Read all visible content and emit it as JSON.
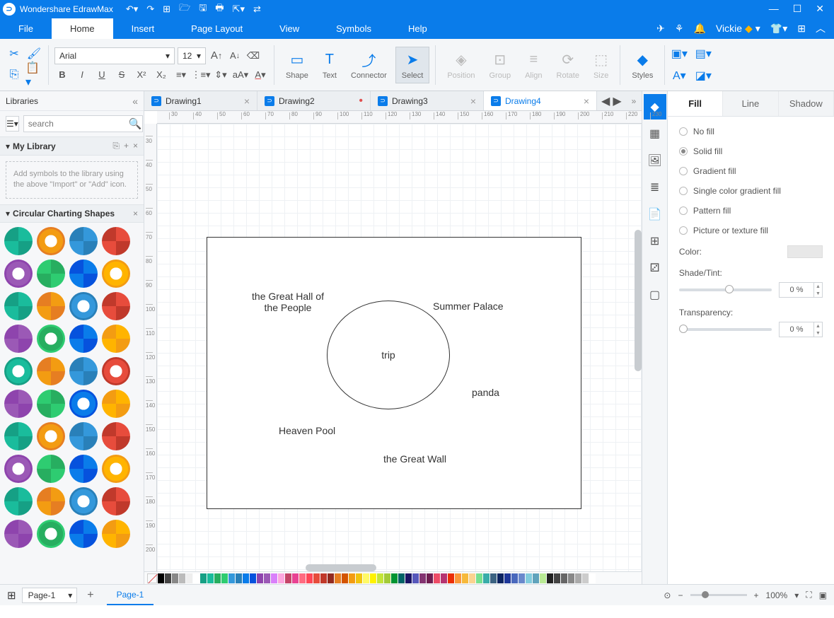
{
  "app": {
    "title": "Wondershare EdrawMax"
  },
  "user": {
    "name": "Vickie"
  },
  "menu": {
    "items": [
      "File",
      "Home",
      "Insert",
      "Page Layout",
      "View",
      "Symbols",
      "Help"
    ],
    "active": 1
  },
  "ribbon": {
    "font_name": "Arial",
    "font_size": "12",
    "tools": {
      "shape": "Shape",
      "text": "Text",
      "connector": "Connector",
      "select": "Select",
      "position": "Position",
      "group": "Group",
      "align": "Align",
      "rotate": "Rotate",
      "size": "Size",
      "styles": "Styles"
    }
  },
  "libraries": {
    "title": "Libraries",
    "search_placeholder": "search",
    "my_library": "My Library",
    "dropzone": "Add symbols to the library using the above \"Import\" or \"Add\" icon.",
    "section": "Circular Charting Shapes"
  },
  "tabs": {
    "items": [
      {
        "name": "Drawing1",
        "modified": false,
        "active": false
      },
      {
        "name": "Drawing2",
        "modified": true,
        "active": false
      },
      {
        "name": "Drawing3",
        "modified": false,
        "active": false
      },
      {
        "name": "Drawing4",
        "modified": false,
        "active": true
      }
    ]
  },
  "canvas": {
    "circle_text": "trip",
    "labels": {
      "great_hall": "the Great Hall of\nthe People",
      "summer_palace": "Summer Palace",
      "panda": "panda",
      "heaven_pool": "Heaven Pool",
      "great_wall": "the Great Wall"
    }
  },
  "side_tools_active": 0,
  "props": {
    "tabs": [
      "Fill",
      "Line",
      "Shadow"
    ],
    "active_tab": 0,
    "fill_options": [
      "No fill",
      "Solid fill",
      "Gradient fill",
      "Single color gradient fill",
      "Pattern fill",
      "Picture or texture fill"
    ],
    "fill_selected": 1,
    "color_label": "Color:",
    "shade_label": "Shade/Tint:",
    "shade_value": "0 %",
    "transp_label": "Transparency:",
    "transp_value": "0 %"
  },
  "status": {
    "page_dd": "Page-1",
    "page_tab": "Page-1",
    "zoom": "100%"
  },
  "palette_colors": [
    "#000",
    "#444",
    "#888",
    "#bbb",
    "#eee",
    "#fff",
    "#16a085",
    "#1abc9c",
    "#27ae60",
    "#2ecc71",
    "#3498db",
    "#2980b9",
    "#0a7cea",
    "#0652dd",
    "#8e44ad",
    "#9b59b6",
    "#d980fa",
    "#fda7df",
    "#c44569",
    "#e84393",
    "#ff6b81",
    "#ff4757",
    "#e74c3c",
    "#c0392b",
    "#922b21",
    "#e67e22",
    "#d35400",
    "#f39c12",
    "#f1c40f",
    "#fffa65",
    "#fff200",
    "#c4e538",
    "#a3cb38",
    "#009432",
    "#006266",
    "#1b1464",
    "#5758bb",
    "#833471",
    "#6f1e51",
    "#ed4c67",
    "#b53471",
    "#eb2f06",
    "#fa983a",
    "#f6b93b",
    "#fad390",
    "#78e08f",
    "#38ada9",
    "#3c6382",
    "#0c2461",
    "#1e3799",
    "#4a69bd",
    "#6a89cc",
    "#82ccdd",
    "#60a3bc",
    "#b8e994",
    "#222",
    "#444",
    "#666",
    "#888",
    "#aaa",
    "#ccc",
    "#fff"
  ]
}
